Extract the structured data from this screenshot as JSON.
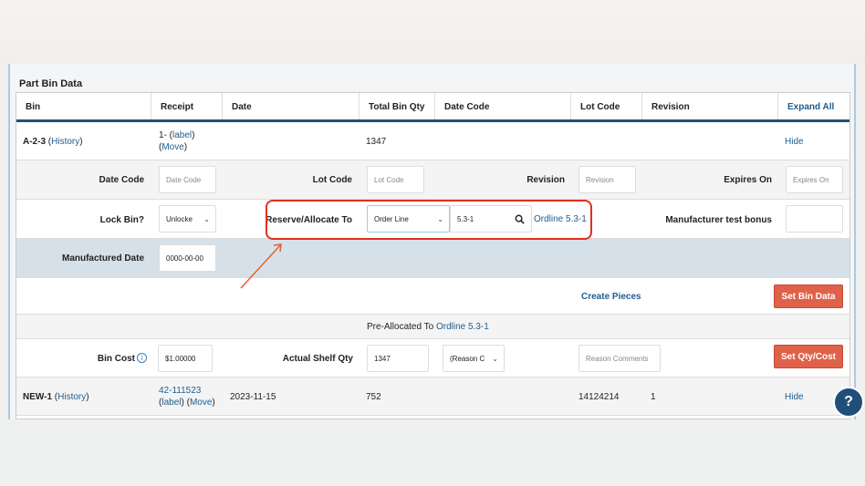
{
  "title": "Part Bin Data",
  "headers": [
    "Bin",
    "Receipt",
    "Date",
    "Total Bin Qty",
    "Date Code",
    "Lot Code",
    "Revision"
  ],
  "expand_all": "Expand All",
  "bin1": {
    "bin": "A-2-3",
    "history": "History",
    "receipt": "1-",
    "label": "label",
    "move": "Move",
    "qty": "1347",
    "hide": "Hide"
  },
  "fields": {
    "date_code_label": "Date Code",
    "date_code_ph": "Date Code",
    "lot_code_label": "Lot Code",
    "lot_code_ph": "Lot Code",
    "revision_label": "Revision",
    "revision_ph": "Revision",
    "expires_label": "Expires On",
    "expires_ph": "Expires On",
    "lock_label": "Lock Bin?",
    "lock_value": "Unlocke",
    "reserve_label": "Reserve/Allocate To",
    "reserve_type": "Order Line",
    "reserve_value": "5.3-1",
    "reserve_link": "Ordline 5.3-1",
    "mfr_bonus_label": "Manufacturer test bonus",
    "mfg_date_label": "Manufactured Date",
    "mfg_date_value": "0000-00-00",
    "create_pieces": "Create Pieces",
    "set_bin_data": "Set Bin Data",
    "pre_allocated": "Pre-Allocated To",
    "pre_allocated_link": "Ordline 5.3-1",
    "bin_cost_label": "Bin Cost",
    "bin_cost_value": "$1.00000",
    "shelf_qty_label": "Actual Shelf Qty",
    "shelf_qty_value": "1347",
    "reason_value": "(Reason C",
    "reason_comments_ph": "Reason Comments",
    "set_qty_cost": "Set Qty/Cost"
  },
  "bin2": {
    "bin": "NEW-1",
    "history": "History",
    "receipt": "42-111523",
    "label": "label",
    "move": "Move",
    "date": "2023-11-15",
    "qty": "752",
    "lot_code": "14124214",
    "revision": "1",
    "hide": "Hide"
  },
  "help": "?",
  "colors": {
    "accent": "#e0614a",
    "link": "#1f5d8f",
    "highlight": "#e0301e"
  }
}
